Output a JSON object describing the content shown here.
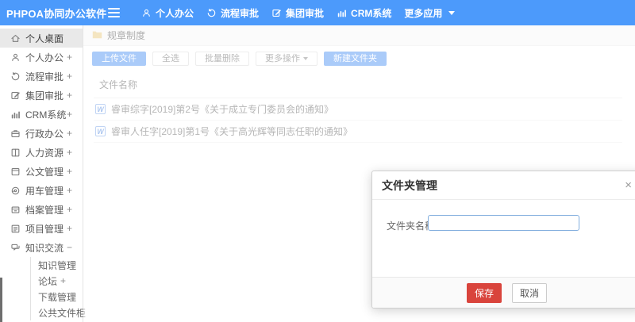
{
  "colors": {
    "navbar_blue": "#4c9afb",
    "button_blue": "#4f92f3",
    "save_red": "#d9443c"
  },
  "topbar": {
    "logo": "PHPOA协同办公软件",
    "items": [
      {
        "name": "personal-office",
        "icon": "user",
        "label": "个人办公"
      },
      {
        "name": "workflow-approval",
        "icon": "history",
        "label": "流程审批"
      },
      {
        "name": "group-approval",
        "icon": "edit",
        "label": "集团审批"
      },
      {
        "name": "crm-system",
        "icon": "chart",
        "label": "CRM系统"
      },
      {
        "name": "more-apps",
        "icon": null,
        "label": "更多应用",
        "caret": true
      }
    ]
  },
  "sidebar": {
    "items": [
      {
        "name": "personal-desktop",
        "icon": "home",
        "label": "个人桌面",
        "active": true
      },
      {
        "name": "personal-office",
        "icon": "user",
        "label": "个人办公",
        "expand": "+"
      },
      {
        "name": "workflow-approval",
        "icon": "history",
        "label": "流程审批",
        "expand": "+"
      },
      {
        "name": "group-approval",
        "icon": "edit",
        "label": "集团审批",
        "expand": "+"
      },
      {
        "name": "crm-system",
        "icon": "chart",
        "label": "CRM系统",
        "expand": "+"
      },
      {
        "name": "administrative-office",
        "icon": "briefcase",
        "label": "行政办公",
        "expand": "+"
      },
      {
        "name": "human-resources",
        "icon": "book",
        "label": "人力资源",
        "expand": "+"
      },
      {
        "name": "document-management",
        "icon": "doc",
        "label": "公文管理",
        "expand": "+"
      },
      {
        "name": "vehicle-management",
        "icon": "car",
        "label": "用车管理",
        "expand": "+"
      },
      {
        "name": "archive-management",
        "icon": "archive",
        "label": "档案管理",
        "expand": "+"
      },
      {
        "name": "project-management",
        "icon": "project",
        "label": "项目管理",
        "expand": "+"
      },
      {
        "name": "knowledge-exchange",
        "icon": "chat",
        "label": "知识交流",
        "expand": "−",
        "children": [
          {
            "name": "knowledge-management",
            "label": "知识管理"
          },
          {
            "name": "forum",
            "label": "论坛",
            "expand": "+"
          },
          {
            "name": "download-management",
            "label": "下载管理"
          },
          {
            "name": "public-file-cabinet",
            "label": "公共文件柜"
          }
        ]
      }
    ]
  },
  "breadcrumb": {
    "label": "规章制度"
  },
  "toolbar": {
    "upload": "上传文件",
    "select_all": "全选",
    "batch_delete": "批量删除",
    "more": "更多操作",
    "new_folder": "新建文件夹"
  },
  "file_table": {
    "header": "文件名称",
    "doc_icon": "W",
    "rows": [
      {
        "name": "睿审综字[2019]第2号《关于成立专门委员会的通知》"
      },
      {
        "name": "睿审人任字[2019]第1号《关于高光辉等同志任职的通知》"
      }
    ]
  },
  "modal": {
    "title": "文件夹管理",
    "close_glyph": "×",
    "field_label": "文件夹名称",
    "input_value": "",
    "save": "保存",
    "cancel": "取消"
  }
}
